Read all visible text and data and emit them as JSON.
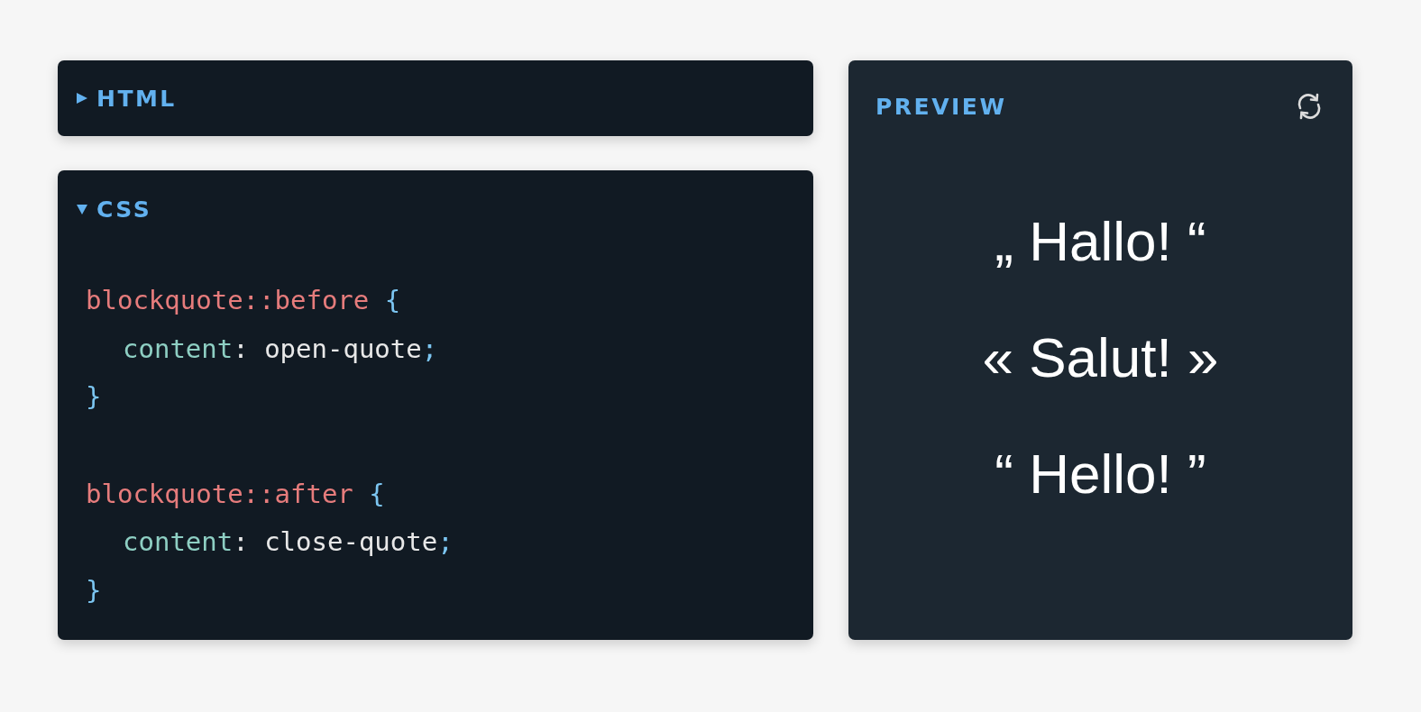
{
  "editors": [
    {
      "title": "HTML",
      "expanded": false
    },
    {
      "title": "CSS",
      "expanded": true,
      "blocks": [
        [
          {
            "indented": false,
            "tokens": [
              {
                "kind": "selector",
                "text": "blockquote::before"
              },
              {
                "kind": "brace",
                "text": " {"
              }
            ]
          },
          {
            "indented": true,
            "tokens": [
              {
                "kind": "property",
                "text": "content"
              },
              {
                "kind": "plain",
                "text": ": open-quote"
              },
              {
                "kind": "brace",
                "text": ";"
              }
            ]
          },
          {
            "indented": false,
            "tokens": [
              {
                "kind": "brace",
                "text": "}"
              }
            ]
          }
        ],
        [
          {
            "indented": false,
            "tokens": [
              {
                "kind": "selector",
                "text": "blockquote::after"
              },
              {
                "kind": "brace",
                "text": " {"
              }
            ]
          },
          {
            "indented": true,
            "tokens": [
              {
                "kind": "property",
                "text": "content"
              },
              {
                "kind": "plain",
                "text": ": close-quote"
              },
              {
                "kind": "brace",
                "text": ";"
              }
            ]
          },
          {
            "indented": false,
            "tokens": [
              {
                "kind": "brace",
                "text": "}"
              }
            ]
          }
        ]
      ]
    }
  ],
  "preview": {
    "title": "PREVIEW",
    "quotes": [
      "„ Hallo! “",
      "« Salut! »",
      "“ Hello! ”"
    ]
  }
}
